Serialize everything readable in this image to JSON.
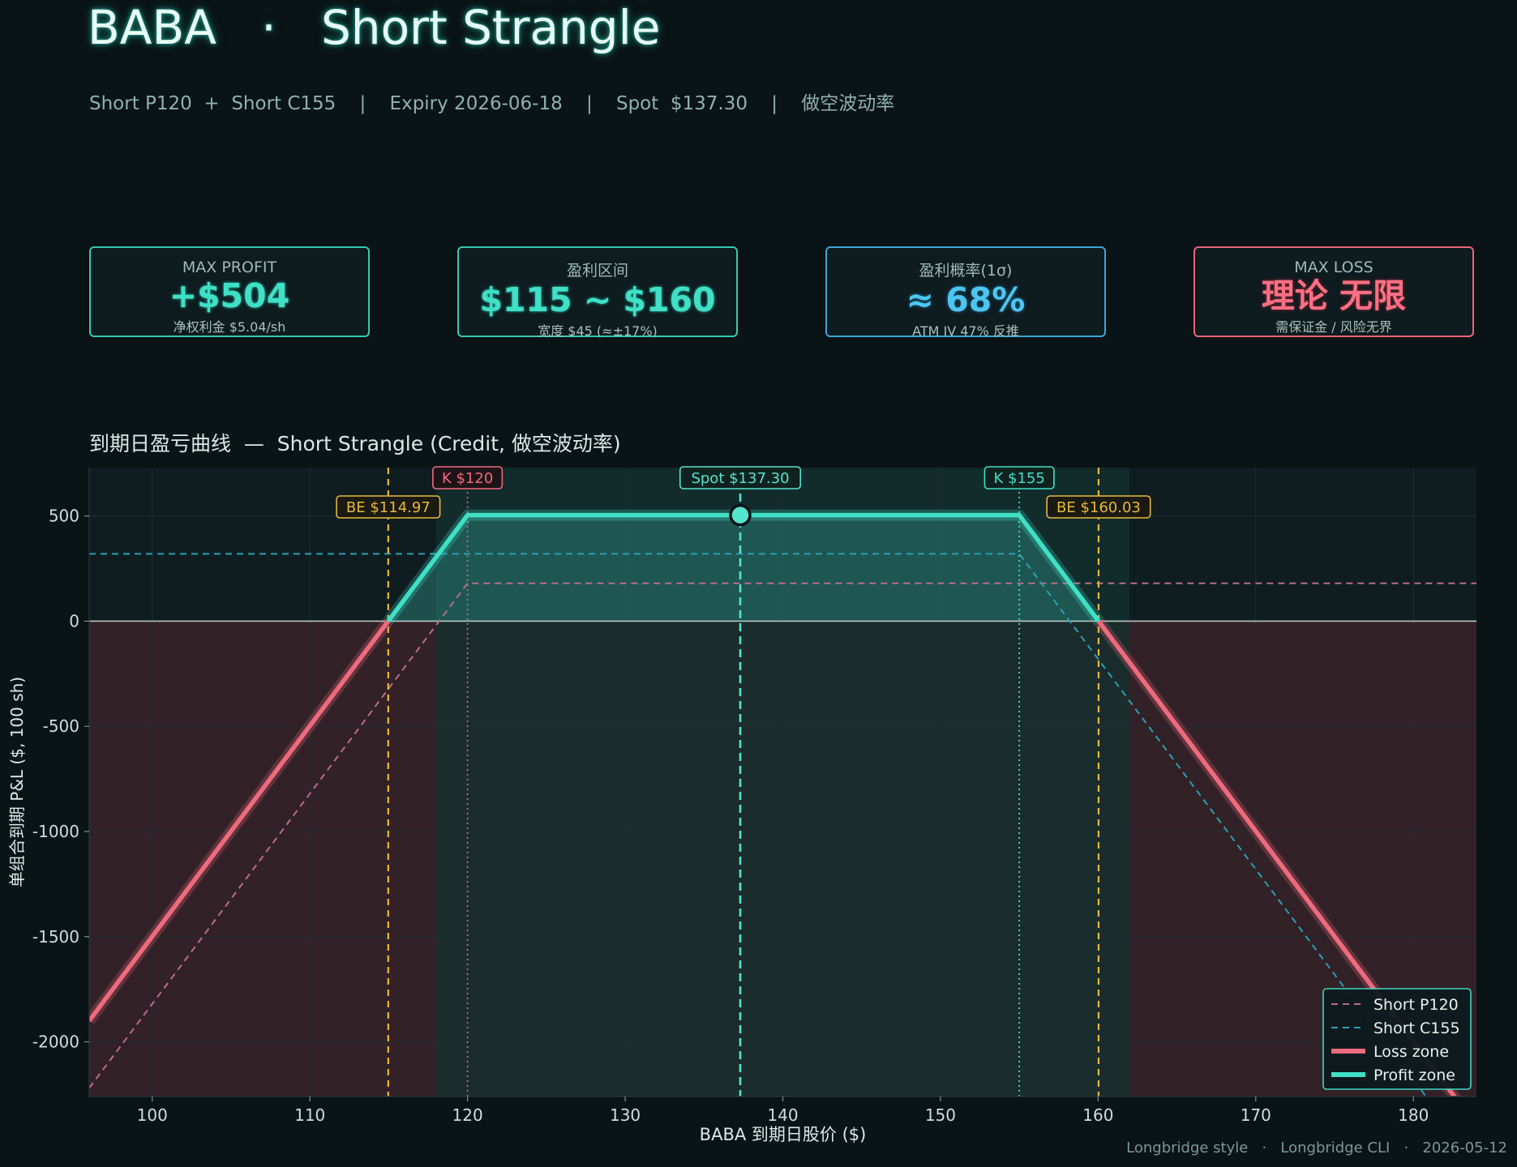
{
  "header": {
    "title": "BABA   ·   Short Strangle",
    "subtitle": "Short P120  +  Short C155    |    Expiry 2026-06-18    |    Spot  $137.30    |    做空波动率"
  },
  "cards": [
    {
      "label": "MAX PROFIT",
      "value": "+$504",
      "sub": "净权利金 $5.04/sh",
      "style": "green"
    },
    {
      "label": "盈利区间",
      "value": "$115 ~ $160",
      "sub": "宽度 $45  (≈±17%)",
      "style": "green"
    },
    {
      "label": "盈利概率(1σ)",
      "value": "≈ 68%",
      "sub": "ATM IV 47%  反推",
      "style": "blue"
    },
    {
      "label": "MAX LOSS",
      "value": "理论 无限",
      "sub": "需保证金 / 风险无界",
      "style": "red"
    }
  ],
  "footer": "Longbridge style   ·   Longbridge CLI   ·   2026-05-12",
  "colors": {
    "profit": "#3fe0c6",
    "loss": "#ee6a7d",
    "breakeven": "#e7b93a",
    "put_leg": "#b96c8c",
    "call_leg": "#2a9fb5",
    "spot": "#56e3ce",
    "zero_line": "#b7c7c4"
  },
  "chart_data": {
    "type": "line",
    "title": "到期日盈亏曲线  —  Short Strangle (Credit, 做空波动率)",
    "xlabel": "BABA 到期日股价 ($)",
    "ylabel": "单组合到期 P&L  ($, 100 sh)",
    "xlim": [
      96,
      184
    ],
    "ylim": [
      -2260,
      730
    ],
    "xticks": [
      100,
      110,
      120,
      130,
      140,
      150,
      160,
      170,
      180
    ],
    "yticks": [
      500,
      0,
      -500,
      -1000,
      -1500,
      -2000
    ],
    "grid": true,
    "legend_position": "bottom-right",
    "series": [
      {
        "name": "Short P120",
        "style": "dashed",
        "x": [
          96,
          120,
          184
        ],
        "y": [
          -2220,
          180,
          180
        ]
      },
      {
        "name": "Short C155",
        "style": "dashed",
        "x": [
          96,
          155,
          184
        ],
        "y": [
          320,
          320,
          -2580
        ]
      },
      {
        "name": "Loss zone",
        "style": "solid",
        "x": [
          96,
          114.97
        ],
        "y": [
          -1900,
          0
        ]
      },
      {
        "name": "Loss zone",
        "style": "solid",
        "x": [
          160.03,
          184
        ],
        "y": [
          0,
          -2400
        ]
      },
      {
        "name": "Profit zone",
        "style": "solid",
        "x": [
          114.97,
          120,
          155,
          160.03
        ],
        "y": [
          0,
          504,
          504,
          0
        ]
      }
    ],
    "legend": [
      "Short P120",
      "Short C155",
      "Loss zone",
      "Profit zone"
    ],
    "annotations": [
      {
        "text": "BE  $114.97",
        "x": 114.97,
        "kind": "breakeven"
      },
      {
        "text": "K  $120",
        "x": 120,
        "kind": "put_strike"
      },
      {
        "text": "Spot  $137.30",
        "x": 137.3,
        "kind": "spot"
      },
      {
        "text": "K  $155",
        "x": 155,
        "kind": "call_strike"
      },
      {
        "text": "BE  $160.03",
        "x": 160.03,
        "kind": "breakeven"
      }
    ],
    "spot_point": {
      "x": 137.3,
      "y": 504
    },
    "profit_band": [
      118,
      162
    ]
  }
}
